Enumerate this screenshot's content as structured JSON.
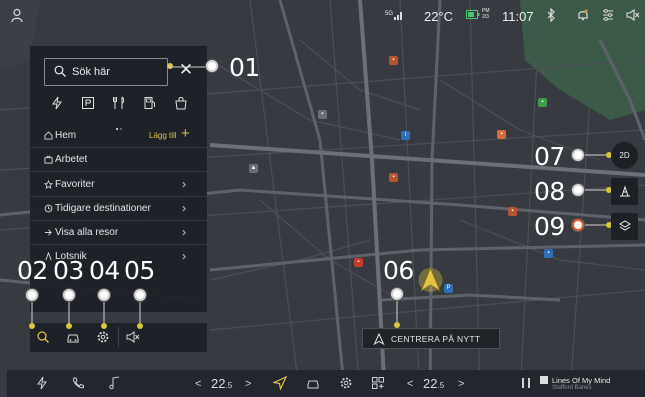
{
  "status_bar": {
    "signal": "5G",
    "temperature": "22°C",
    "battery_time_top": "PM",
    "battery_time_bottom": "2/3",
    "clock": "11:07"
  },
  "search": {
    "placeholder": "Sök här"
  },
  "categories": [
    "charging-icon",
    "parking-icon",
    "restaurant-icon",
    "fuel-icon",
    "shopping-icon"
  ],
  "destinations": [
    {
      "label": "Hem",
      "icon": "home-icon",
      "action": "Lägg till"
    },
    {
      "label": "Arbetet",
      "icon": "work-icon"
    },
    {
      "label": "Favoriter",
      "icon": "star-icon"
    },
    {
      "label": "Tidigare destinationer",
      "icon": "history-icon"
    },
    {
      "label": "Visa alla resor",
      "icon": "trips-icon"
    },
    {
      "label": "Lotsnik",
      "icon": "route-icon"
    }
  ],
  "callouts": [
    "01",
    "02",
    "03",
    "04",
    "05",
    "06",
    "07",
    "08",
    "09"
  ],
  "map_controls": {
    "view_mode": "2D"
  },
  "recenter_label": "CENTRERA PÅ NYTT",
  "dock": {
    "temp_left": "22",
    "temp_left_decimal": ".5",
    "temp_right": "22",
    "temp_right_decimal": ".5",
    "nav_left": "<",
    "nav_right": ">",
    "media_title": "Lines Of My Mind",
    "media_artist": "Stafford Banes"
  },
  "colors": {
    "accent": "#e3c342",
    "map_bg": "#373b41",
    "panel_bg": "#1e2227",
    "park": "#3c5a48"
  }
}
